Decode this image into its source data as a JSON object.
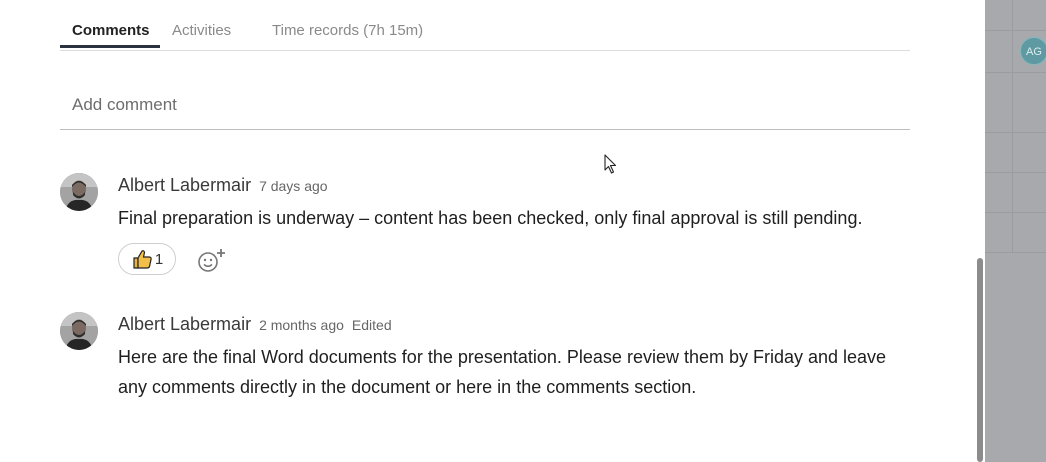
{
  "tabs": [
    {
      "label": "Comments",
      "active": true
    },
    {
      "label": "Activities",
      "active": false
    },
    {
      "label": "Time records (7h 15m)",
      "active": false
    }
  ],
  "add_comment": {
    "placeholder": "Add comment"
  },
  "comments": [
    {
      "author": "Albert Labermair",
      "time": "7 days ago",
      "edited": "",
      "text": "Final preparation is underway – content has been checked, only final approval is still pending.",
      "reaction": {
        "icon": "thumbs-up-icon",
        "count": "1"
      }
    },
    {
      "author": "Albert Labermair",
      "time": "2 months ago",
      "edited": "Edited",
      "text": "Here are the final Word documents for the presentation. Please review them by Friday and leave any comments directly in the document or here in the comments section."
    }
  ],
  "backdrop": {
    "avatar_initials": "AG"
  },
  "colors": {
    "tab_underline": "#2b3240",
    "backdrop": "#a7a9ad",
    "avatar_teal": "#5f9aa3"
  }
}
